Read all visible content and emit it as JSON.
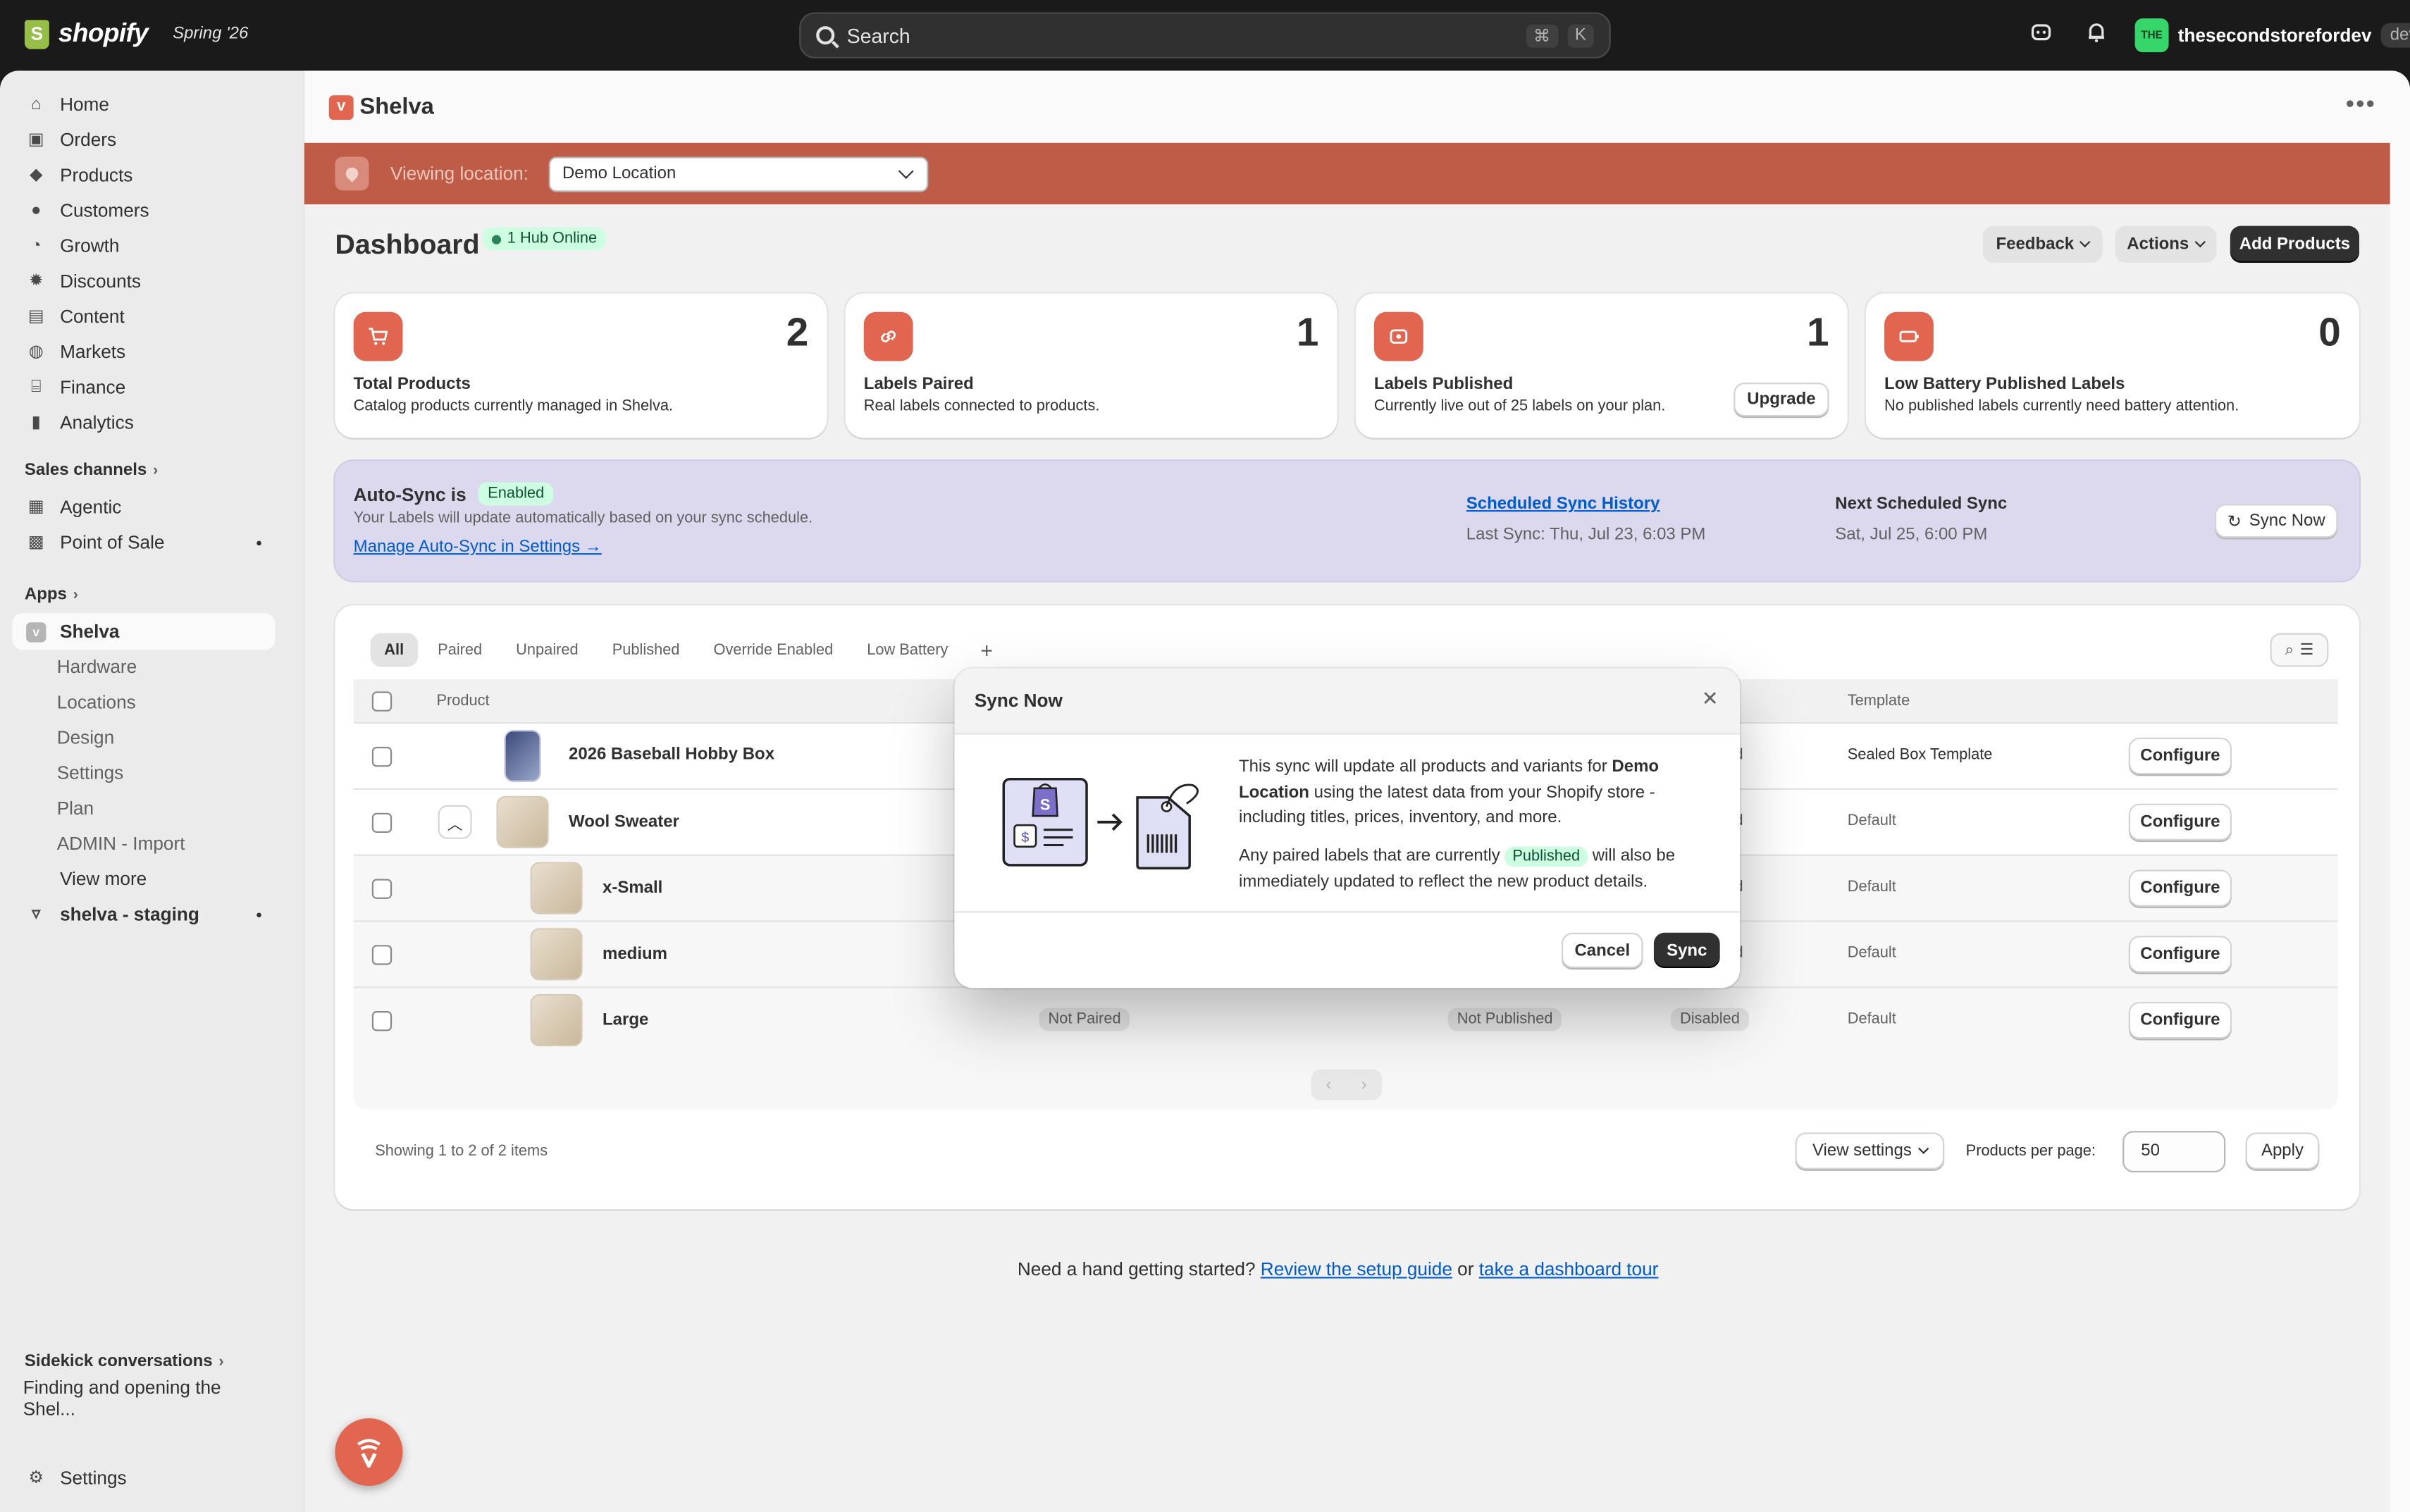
{
  "topbar": {
    "brand": "shopify",
    "season": "Spring '26",
    "search_placeholder": "Search",
    "kbd1": "⌘",
    "kbd2": "K",
    "store_initials": "THE",
    "store_name": "thesecondstorefordev",
    "store_badge": "dev"
  },
  "sidebar": {
    "items": [
      {
        "label": "Home",
        "icon": "home-icon"
      },
      {
        "label": "Orders",
        "icon": "inbox-icon"
      },
      {
        "label": "Products",
        "icon": "tag-icon"
      },
      {
        "label": "Customers",
        "icon": "person-icon"
      },
      {
        "label": "Growth",
        "icon": "gauge-icon"
      },
      {
        "label": "Discounts",
        "icon": "discount-icon"
      },
      {
        "label": "Content",
        "icon": "content-icon"
      },
      {
        "label": "Markets",
        "icon": "globe-icon"
      },
      {
        "label": "Finance",
        "icon": "bank-icon"
      },
      {
        "label": "Analytics",
        "icon": "chart-icon"
      }
    ],
    "sales_channels_label": "Sales channels",
    "channels": [
      {
        "label": "Agentic"
      },
      {
        "label": "Point of Sale"
      }
    ],
    "apps_label": "Apps",
    "apps": [
      {
        "label": "Shelva"
      },
      {
        "label": "Hardware"
      },
      {
        "label": "Locations"
      },
      {
        "label": "Design"
      },
      {
        "label": "Settings"
      },
      {
        "label": "Plan"
      },
      {
        "label": "ADMIN - Import"
      },
      {
        "label": "View more"
      },
      {
        "label": "shelva - staging"
      }
    ],
    "sidekick_label": "Sidekick conversations",
    "sidekick_item": "Finding and opening the Shel...",
    "settings_label": "Settings"
  },
  "app": {
    "title": "Shelva",
    "viewing_label": "Viewing location:",
    "location_value": "Demo Location",
    "dashboard_title": "Dashboard",
    "hub_status": "1 Hub Online",
    "feedback_label": "Feedback",
    "actions_label": "Actions",
    "add_products_label": "Add Products"
  },
  "stats": [
    {
      "value": "2",
      "title": "Total Products",
      "desc": "Catalog products currently managed in Shelva."
    },
    {
      "value": "1",
      "title": "Labels Paired",
      "desc": "Real labels connected to products."
    },
    {
      "value": "1",
      "title": "Labels Published",
      "desc": "Currently live out of 25 labels on your plan.",
      "button": "Upgrade"
    },
    {
      "value": "0",
      "title": "Low Battery Published Labels",
      "desc": "No published labels currently need battery attention."
    }
  ],
  "autosync": {
    "heading": "Auto-Sync is",
    "status": "Enabled",
    "desc": "Your Labels will update automatically based on your sync schedule.",
    "manage_link": "Manage Auto-Sync in Settings →",
    "history_link": "Scheduled Sync History",
    "last_sync": "Last Sync: Thu, Jul 23, 6:03 PM",
    "next_heading": "Next Scheduled Sync",
    "next_sync": "Sat, Jul 25, 6:00 PM",
    "sync_now_label": "Sync Now"
  },
  "table": {
    "tabs": [
      "All",
      "Paired",
      "Unpaired",
      "Published",
      "Override Enabled",
      "Low Battery"
    ],
    "add_tab": "+",
    "headers": {
      "product": "Product",
      "template": "Template",
      "status_partial": "s"
    },
    "rows": [
      {
        "name": "2026 Baseball Hobby Box",
        "col_e": "ed",
        "template": "Sealed Box Template",
        "action": "Configure"
      },
      {
        "name": "Wool Sweater",
        "col_e": "ed",
        "template": "Default",
        "action": "Configure"
      },
      {
        "name": "x-Small",
        "col_e": "ed",
        "template": "Default",
        "action": "Configure"
      },
      {
        "name": "medium",
        "col_e": "ed",
        "template": "Default",
        "action": "Configure"
      },
      {
        "name": "Large",
        "pair": "Not Paired",
        "pub": "Not Published",
        "col_e": "Disabled",
        "template": "Default",
        "action": "Configure"
      }
    ],
    "showing": "Showing 1 to 2 of 2 items",
    "view_settings": "View settings",
    "per_page_label": "Products per page:",
    "per_page_value": "50",
    "apply_label": "Apply"
  },
  "help": {
    "prefix": "Need a hand getting started?",
    "guide_link": "Review the setup guide",
    "or": "or",
    "tour_link": "take a dashboard tour"
  },
  "modal": {
    "title": "Sync Now",
    "p1_a": "This sync will update all products and variants for",
    "p1_bold": "Demo Location",
    "p1_b": "using the latest data from your Shopify store - including titles, prices, inventory, and more.",
    "p2_a": "Any paired labels that are currently",
    "p2_pill": "Published",
    "p2_b": "will also be immediately updated to reflect the new product details.",
    "cancel_label": "Cancel",
    "sync_label": "Sync"
  },
  "colors": {
    "accent": "#e2664f",
    "location_bar": "#bf5c48",
    "autosync_bg": "#dcd9ee",
    "success_bg": "#cdfee1"
  }
}
